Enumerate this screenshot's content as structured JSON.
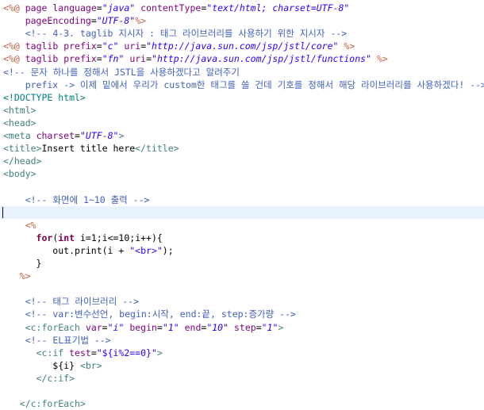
{
  "editor": {
    "colors": {
      "directive": "#bf5f3f",
      "comment": "#3f5fbf",
      "tag": "#3f7f7f",
      "attribute": "#7f007f",
      "string": "#2a00ff",
      "keyword": "#7f0055",
      "current_line": "#e8f2fe"
    },
    "lines": [
      [
        [
          "dir",
          "<%@"
        ],
        [
          "plain",
          " "
        ],
        [
          "attr",
          "page"
        ],
        [
          "plain",
          " "
        ],
        [
          "attr",
          "language"
        ],
        [
          "plain",
          "="
        ],
        [
          "str",
          "\"java\""
        ],
        [
          "plain",
          " "
        ],
        [
          "attr",
          "contentType"
        ],
        [
          "plain",
          "="
        ],
        [
          "str",
          "\"text/html; charset=UTF-8\""
        ]
      ],
      [
        [
          "plain",
          "    "
        ],
        [
          "attr",
          "pageEncoding"
        ],
        [
          "plain",
          "="
        ],
        [
          "str",
          "\"UTF-8\""
        ],
        [
          "dir",
          "%>"
        ]
      ],
      [
        [
          "plain",
          "    "
        ],
        [
          "cmt",
          "<!-- 4-3. taglib 지시자 : 태그 라이브러리를 사용하기 위한 지시자 -->"
        ]
      ],
      [
        [
          "dir",
          "<%@"
        ],
        [
          "plain",
          " "
        ],
        [
          "attr",
          "taglib"
        ],
        [
          "plain",
          " "
        ],
        [
          "attr",
          "prefix"
        ],
        [
          "plain",
          "="
        ],
        [
          "str",
          "\"c\""
        ],
        [
          "plain",
          " "
        ],
        [
          "attr",
          "uri"
        ],
        [
          "plain",
          "="
        ],
        [
          "str",
          "\"http://java.sun.com/jsp/jstl/core\""
        ],
        [
          "plain",
          " "
        ],
        [
          "dir",
          "%>"
        ]
      ],
      [
        [
          "dir",
          "<%@"
        ],
        [
          "plain",
          " "
        ],
        [
          "attr",
          "taglib"
        ],
        [
          "plain",
          " "
        ],
        [
          "attr",
          "prefix"
        ],
        [
          "plain",
          "="
        ],
        [
          "str",
          "\"fn\""
        ],
        [
          "plain",
          " "
        ],
        [
          "attr",
          "uri"
        ],
        [
          "plain",
          "="
        ],
        [
          "str",
          "\"http://java.sun.com/jsp/jstl/functions\""
        ],
        [
          "plain",
          " "
        ],
        [
          "dir",
          "%>"
        ]
      ],
      [
        [
          "cmt",
          "<!-- 문자 하나를 정해서 JSTL을 사용하겠다고 알려주기"
        ]
      ],
      [
        [
          "cmt",
          "    prefix -> 이제 밑에서 우리가 custom한 태그를 쓸 건데 기호를 정해서 해당 라이브러리를 사용하겠다! -->"
        ]
      ],
      [
        [
          "doc",
          "<!DOCTYPE html>"
        ]
      ],
      [
        [
          "tag",
          "<html>"
        ]
      ],
      [
        [
          "tag",
          "<head>"
        ]
      ],
      [
        [
          "tag",
          "<meta"
        ],
        [
          "plain",
          " "
        ],
        [
          "attr",
          "charset"
        ],
        [
          "plain",
          "="
        ],
        [
          "str",
          "\"UTF-8\""
        ],
        [
          "tag",
          ">"
        ]
      ],
      [
        [
          "tag",
          "<title>"
        ],
        [
          "plain",
          "Insert title here"
        ],
        [
          "tag",
          "</title>"
        ]
      ],
      [
        [
          "tag",
          "</head>"
        ]
      ],
      [
        [
          "tag",
          "<body>"
        ]
      ],
      [],
      [
        [
          "plain",
          "    "
        ],
        [
          "cmt",
          "<!-- 화면에 1~10 출력 -->"
        ]
      ],
      [],
      [
        [
          "plain",
          "    "
        ],
        [
          "dir",
          "<%"
        ]
      ],
      [
        [
          "plain",
          "      "
        ],
        [
          "kw",
          "for"
        ],
        [
          "plain",
          "("
        ],
        [
          "kw",
          "int"
        ],
        [
          "plain",
          " i=1;i<=10;i++){"
        ]
      ],
      [
        [
          "plain",
          "         out.print(i + "
        ],
        [
          "strn",
          "\"<br>\""
        ],
        [
          "plain",
          ");"
        ]
      ],
      [
        [
          "plain",
          "      }"
        ]
      ],
      [
        [
          "plain",
          "   "
        ],
        [
          "dir",
          "%>"
        ]
      ],
      [],
      [
        [
          "plain",
          "    "
        ],
        [
          "cmt",
          "<!-- 태그 라이브러리 -->"
        ]
      ],
      [
        [
          "plain",
          "    "
        ],
        [
          "cmt",
          "<!-- var:변수선언, begin:시작, end:끝, step:증가량 -->"
        ]
      ],
      [
        [
          "plain",
          "    "
        ],
        [
          "tag",
          "<c:forEach"
        ],
        [
          "plain",
          " "
        ],
        [
          "attr",
          "var"
        ],
        [
          "plain",
          "="
        ],
        [
          "str",
          "\"i\""
        ],
        [
          "plain",
          " "
        ],
        [
          "attr",
          "begin"
        ],
        [
          "plain",
          "="
        ],
        [
          "str",
          "\"1\""
        ],
        [
          "plain",
          " "
        ],
        [
          "attr",
          "end"
        ],
        [
          "plain",
          "="
        ],
        [
          "str",
          "\"10\""
        ],
        [
          "plain",
          " "
        ],
        [
          "attr",
          "step"
        ],
        [
          "plain",
          "="
        ],
        [
          "str",
          "\"1\""
        ],
        [
          "tag",
          ">"
        ]
      ],
      [
        [
          "plain",
          "    "
        ],
        [
          "cmt",
          "<!-- EL표기법 -->"
        ]
      ],
      [
        [
          "plain",
          "      "
        ],
        [
          "tag",
          "<c:if"
        ],
        [
          "plain",
          " "
        ],
        [
          "attr",
          "test"
        ],
        [
          "plain",
          "="
        ],
        [
          "strn",
          "\"${i%2==0}\""
        ],
        [
          "tag",
          ">"
        ]
      ],
      [
        [
          "plain",
          "         ${i} "
        ],
        [
          "tag",
          "<br>"
        ]
      ],
      [
        [
          "plain",
          "      "
        ],
        [
          "tag",
          "</c:if>"
        ]
      ],
      [],
      [
        [
          "plain",
          "   "
        ],
        [
          "tag",
          "</c:forEach>"
        ]
      ]
    ],
    "current_line_index": 16
  }
}
